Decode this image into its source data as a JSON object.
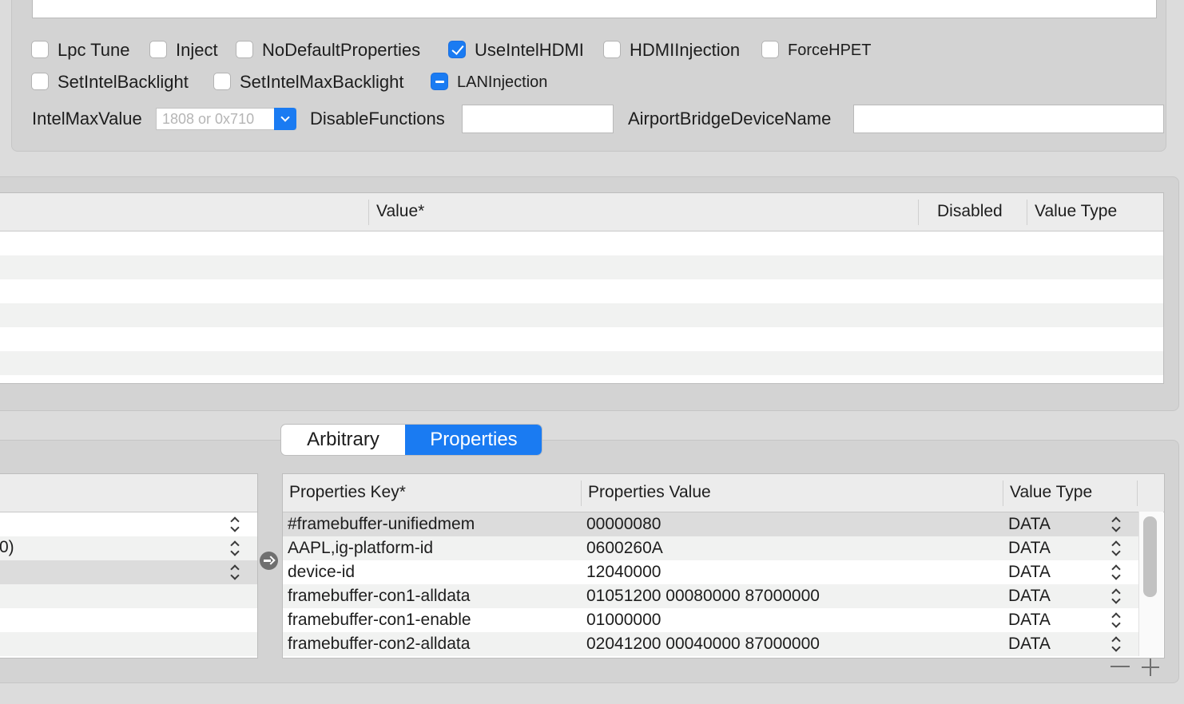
{
  "options": {
    "row1": [
      {
        "label": "Lpc Tune",
        "checked": false
      },
      {
        "label": "Inject",
        "checked": false
      },
      {
        "label": "NoDefaultProperties",
        "checked": false
      },
      {
        "label": "UseIntelHDMI",
        "checked": true
      },
      {
        "label": "HDMIInjection",
        "checked": false
      },
      {
        "label": "ForceHPET",
        "checked": false
      }
    ],
    "row2": [
      {
        "label": "SetIntelBacklight",
        "checked": false
      },
      {
        "label": "SetIntelMaxBacklight",
        "checked": false
      },
      {
        "label": "LANInjection",
        "state": "mixed"
      }
    ],
    "intel_max_value_label": "IntelMaxValue",
    "intel_max_value_placeholder": "1808 or 0x710",
    "disable_functions_label": "DisableFunctions",
    "disable_functions_value": "",
    "airport_bridge_label": "AirportBridgeDeviceName",
    "airport_bridge_value": ""
  },
  "middle_table": {
    "columns": [
      "Value*",
      "Disabled",
      "Value Type"
    ]
  },
  "tabs": {
    "items": [
      "Arbitrary",
      "Properties"
    ],
    "selected": "Properties"
  },
  "left_table": {
    "partial_cell": "0)"
  },
  "properties_table": {
    "columns": [
      "Properties Key*",
      "Properties Value",
      "Value Type"
    ],
    "rows": [
      {
        "key": "#framebuffer-unifiedmem",
        "value": "00000080",
        "type": "DATA"
      },
      {
        "key": "AAPL,ig-platform-id",
        "value": "0600260A",
        "type": "DATA"
      },
      {
        "key": "device-id",
        "value": "12040000",
        "type": "DATA"
      },
      {
        "key": "framebuffer-con1-alldata",
        "value": "01051200 00080000 87000000",
        "type": "DATA"
      },
      {
        "key": "framebuffer-con1-enable",
        "value": "01000000",
        "type": "DATA"
      },
      {
        "key": "framebuffer-con2-alldata",
        "value": "02041200 00040000 87000000",
        "type": "DATA"
      }
    ]
  },
  "colors": {
    "accent": "#1a7bf2",
    "panel": "#d3d3d3",
    "stripe": "#f1f2f1"
  },
  "icons": [
    "checkbox-icon",
    "dropdown-chevron-icon",
    "stepper-icon",
    "arrow-right-circle-icon",
    "minus-icon",
    "plus-icon"
  ]
}
